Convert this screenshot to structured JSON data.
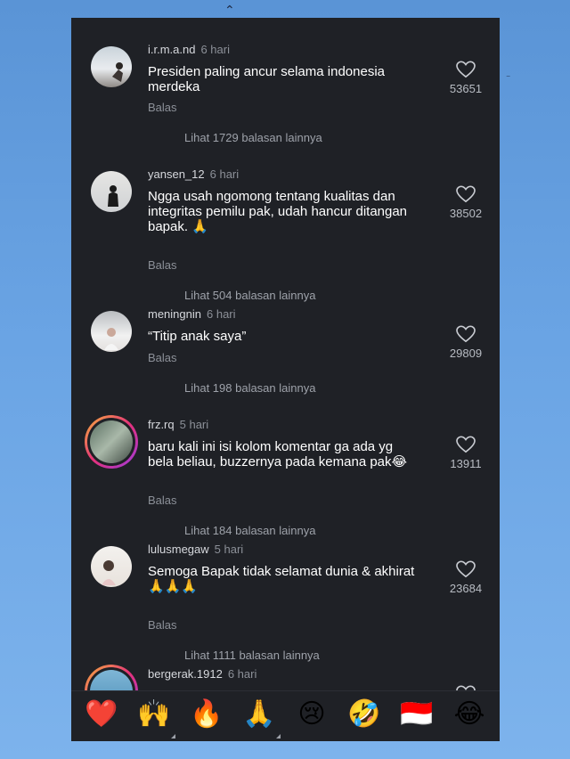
{
  "comments": [
    {
      "username": "i.r.m.a.nd",
      "time": "6 hari",
      "text_lines": [
        "Presiden paling ancur selama indonesia",
        "merdeka"
      ],
      "reply": "Balas",
      "view_replies": "Lihat 1729 balasan lainnya",
      "likes": "53651"
    },
    {
      "username": "yansen_12",
      "time": "6 hari",
      "text_lines": [
        "Ngga usah ngomong tentang kualitas dan",
        "integritas pemilu pak, udah hancur ditangan",
        "bapak. 🙏"
      ],
      "reply": "Balas",
      "view_replies": "Lihat 504 balasan lainnya",
      "likes": "38502"
    },
    {
      "username": "meningnin",
      "time": "6 hari",
      "text_lines": [
        "“Titip anak saya”"
      ],
      "reply": "Balas",
      "view_replies": "Lihat 198 balasan lainnya",
      "likes": "29809"
    },
    {
      "username": "frz.rq",
      "time": "5 hari",
      "text_lines": [
        "baru kali ini isi kolom komentar ga ada yg",
        "bela beliau, buzzernya pada kemana pak😂"
      ],
      "reply": "Balas",
      "view_replies": "Lihat 184 balasan lainnya",
      "likes": "13911"
    },
    {
      "username": "lulusmegaw",
      "time": "5 hari",
      "text_lines": [
        "Semoga Bapak tidak selamat dunia & akhirat",
        "🙏🙏🙏"
      ],
      "reply": "Balas",
      "view_replies": "Lihat 1111 balasan lainnya",
      "likes": "23684"
    },
    {
      "username": "bergerak.1912",
      "time": "6 hari"
    }
  ],
  "emoji_bar": [
    "❤️",
    "🙌",
    "🔥",
    "🙏",
    "😢",
    "🤣",
    "🇮🇩",
    "😂"
  ],
  "colors": {
    "panel": "#1f2126",
    "text": "#ffffff",
    "muted": "#8c9098",
    "background": "#6aa4e4"
  },
  "icons": [
    "heart-outline-icon",
    "bird-silhouette"
  ]
}
